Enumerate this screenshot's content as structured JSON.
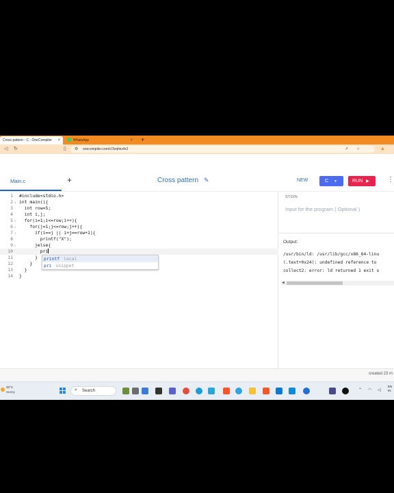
{
  "browser": {
    "tabs": [
      {
        "title": "Cross pattern - C - OneCompiler",
        "close": "×"
      },
      {
        "title": "WhatsApp",
        "close": "×"
      }
    ],
    "new_tab": "+",
    "url": "onecompiler.com/c/3zqhtu4x3"
  },
  "app": {
    "file_tab": "Main.c",
    "add_file": "+",
    "title": "Cross pattern",
    "new_label": "NEW",
    "language": "C",
    "run_label": "RUN"
  },
  "editor": {
    "lines": [
      {
        "n": "1",
        "fold": "",
        "code": "#include<stdio.h>"
      },
      {
        "n": "2",
        "fold": "▾",
        "code": "int main(){"
      },
      {
        "n": "3",
        "fold": "",
        "code": "  int row=5;"
      },
      {
        "n": "4",
        "fold": "",
        "code": "  int i,j;"
      },
      {
        "n": "5",
        "fold": "▾",
        "code": "  for(i=1;i<=row;i++){"
      },
      {
        "n": "6",
        "fold": "▾",
        "code": "    for(j=1;j<=row;j++){"
      },
      {
        "n": "7",
        "fold": "▾",
        "code": "      if(i==j || i+j==row+1){"
      },
      {
        "n": "8",
        "fold": "",
        "code": "        printf(\"X\");"
      },
      {
        "n": "9",
        "fold": "▾",
        "code": "      }else{"
      },
      {
        "n": "10",
        "fold": "",
        "code": "        pri"
      },
      {
        "n": "11",
        "fold": "",
        "code": "      }"
      },
      {
        "n": "12",
        "fold": "",
        "code": "    }"
      },
      {
        "n": "13",
        "fold": "",
        "code": "  }"
      },
      {
        "n": "14",
        "fold": "",
        "code": "}"
      }
    ],
    "active_line": 10,
    "suggestions": [
      {
        "word": "printf",
        "kind": "local"
      },
      {
        "word": "pri",
        "kind": "snippet"
      }
    ]
  },
  "io": {
    "stdin_label": "STDIN",
    "stdin_placeholder": "Input for the program ( Optional )",
    "output_label": "Output:",
    "output_lines": [
      "/usr/bin/ld: /usr/lib/gcc/x86_64-linu",
      "(.text+0x24): undefined reference to",
      "collect2: error: ld returned 1 exit s"
    ]
  },
  "footer": {
    "created": "created 23 m"
  },
  "taskbar": {
    "weather_temp": "32°C",
    "weather_desc": "Sunny",
    "search_label": "Search",
    "clock_line1": "EN",
    "clock_line2": "IN"
  },
  "colors": {
    "tab_strip": "#f28b22",
    "accent_blue": "#2f6fb4",
    "language_button": "#4b6cf0",
    "run_button": "#e8234e"
  }
}
